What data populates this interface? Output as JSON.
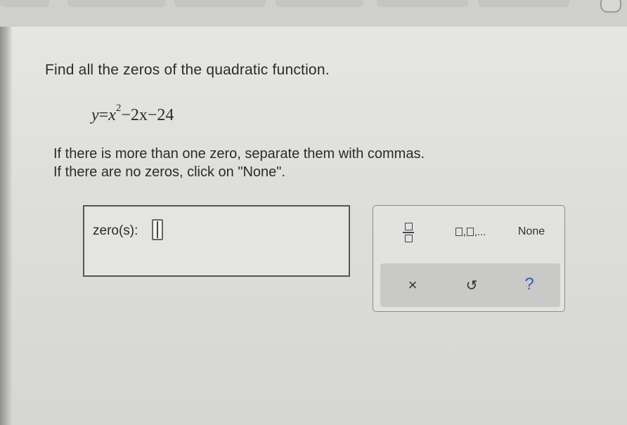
{
  "prompt": "Find all the zeros of the quadratic function.",
  "equation": {
    "lhs": "y",
    "equals": "=",
    "base": "x",
    "exponent": "2",
    "rest": "−2x−24"
  },
  "instructions": {
    "line1": "If there is more than one zero, separate them with commas.",
    "line2": "If there are no zeros, click on \"None\"."
  },
  "answer": {
    "label": "zero(s):",
    "value": ""
  },
  "keypad": {
    "fraction_icon": "fraction-icon",
    "list_label": ",",
    "list_ellipsis": "...",
    "none_label": "None",
    "clear_symbol": "×",
    "undo_symbol": "↺",
    "help_symbol": "?"
  }
}
